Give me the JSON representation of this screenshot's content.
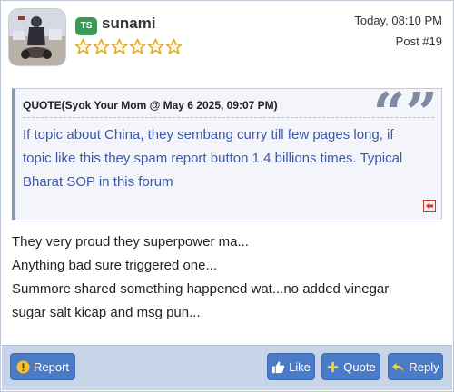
{
  "post": {
    "username": "sunami",
    "user_badge": "TS",
    "rating_stars": 6,
    "rating_filled": 0,
    "timestamp": "Today, 08:10 PM",
    "post_number": "Post #19"
  },
  "quote": {
    "header": "QUOTE(Syok Your Mom @ May 6 2025, 09:07 PM)",
    "lines": [
      "If topic about China, they sembang curry till few pages long, if",
      "topic like this they spam report button 1.4 billions times. Typical",
      "Bharat SOP in this forum"
    ],
    "mark_glyph": "“”",
    "link_icon": "back-to-source-icon"
  },
  "message": {
    "lines": [
      "They very proud they superpower ma...",
      "Anything bad sure triggered one...",
      "Summore shared something happened wat...no added vinegar",
      "sugar salt kicap and msg pun..."
    ]
  },
  "footer": {
    "report_label": "Report",
    "like_label": "Like",
    "quote_label": "Quote",
    "reply_label": "Reply"
  },
  "colors": {
    "badge": "#3a9a54",
    "button": "#4a7bc8",
    "footer_bg": "#c8d4e8",
    "quote_text": "#3d58a8",
    "star_outline": "#e0a820"
  }
}
